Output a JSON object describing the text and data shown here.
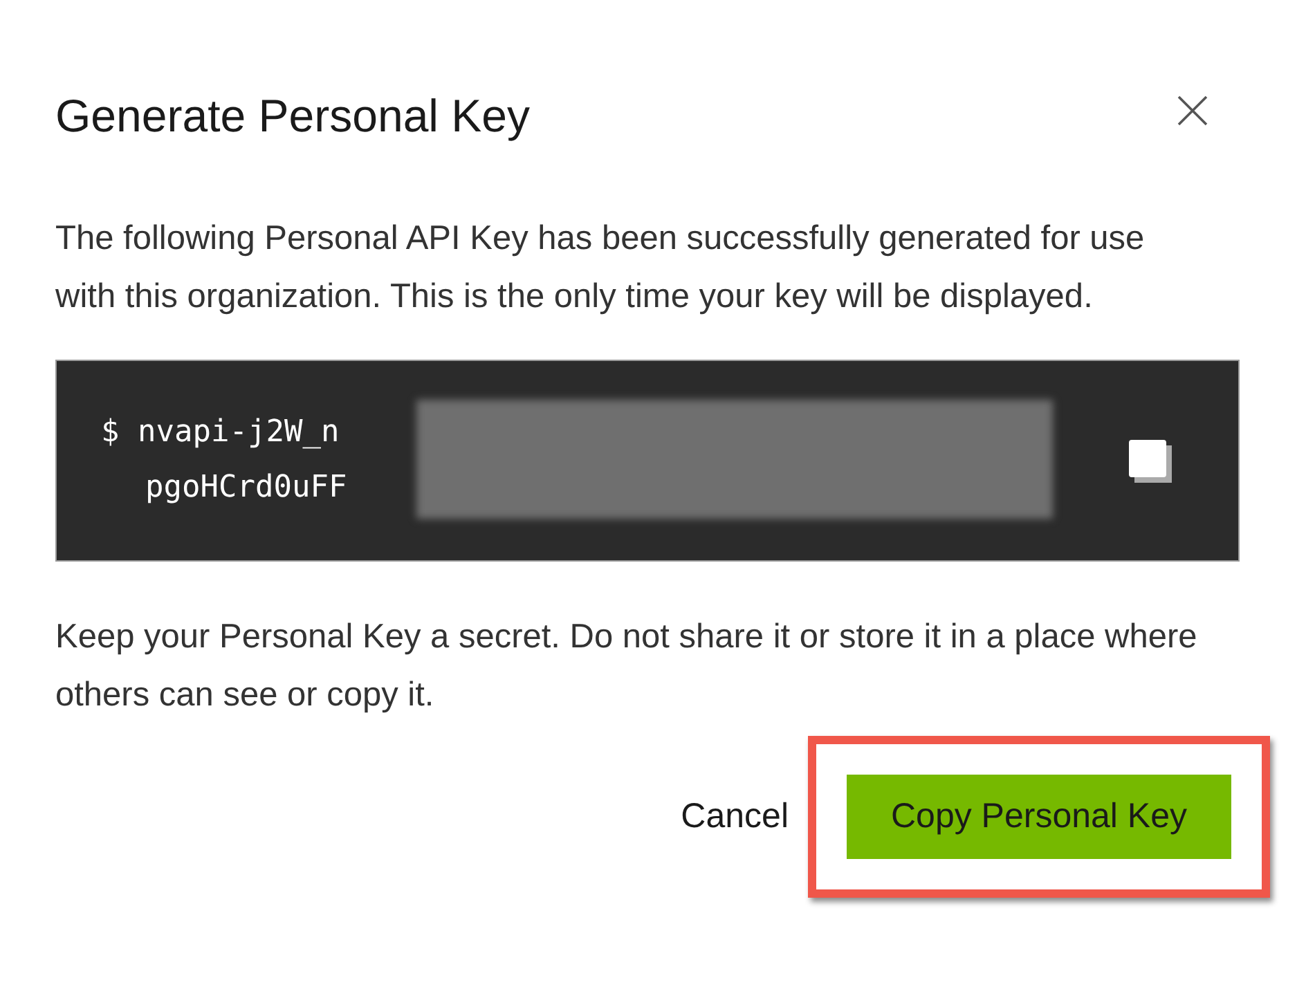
{
  "dialog": {
    "title": "Generate Personal Key"
  },
  "message": "The following Personal API Key has been successfully generated for use with this organization. This is the only time your key will be displayed.",
  "key_lines": [
    "$ nvapi-j2W_n",
    "pgoHCrd0uFF"
  ],
  "warning": "Keep your Personal Key a secret. Do not share it or store it in a place where others can see or copy it.",
  "buttons": [
    {
      "label": "Cancel",
      "kind": "text",
      "highlighted": false
    },
    {
      "label": "Copy Personal Key",
      "kind": "primary",
      "highlighted": true
    }
  ]
}
